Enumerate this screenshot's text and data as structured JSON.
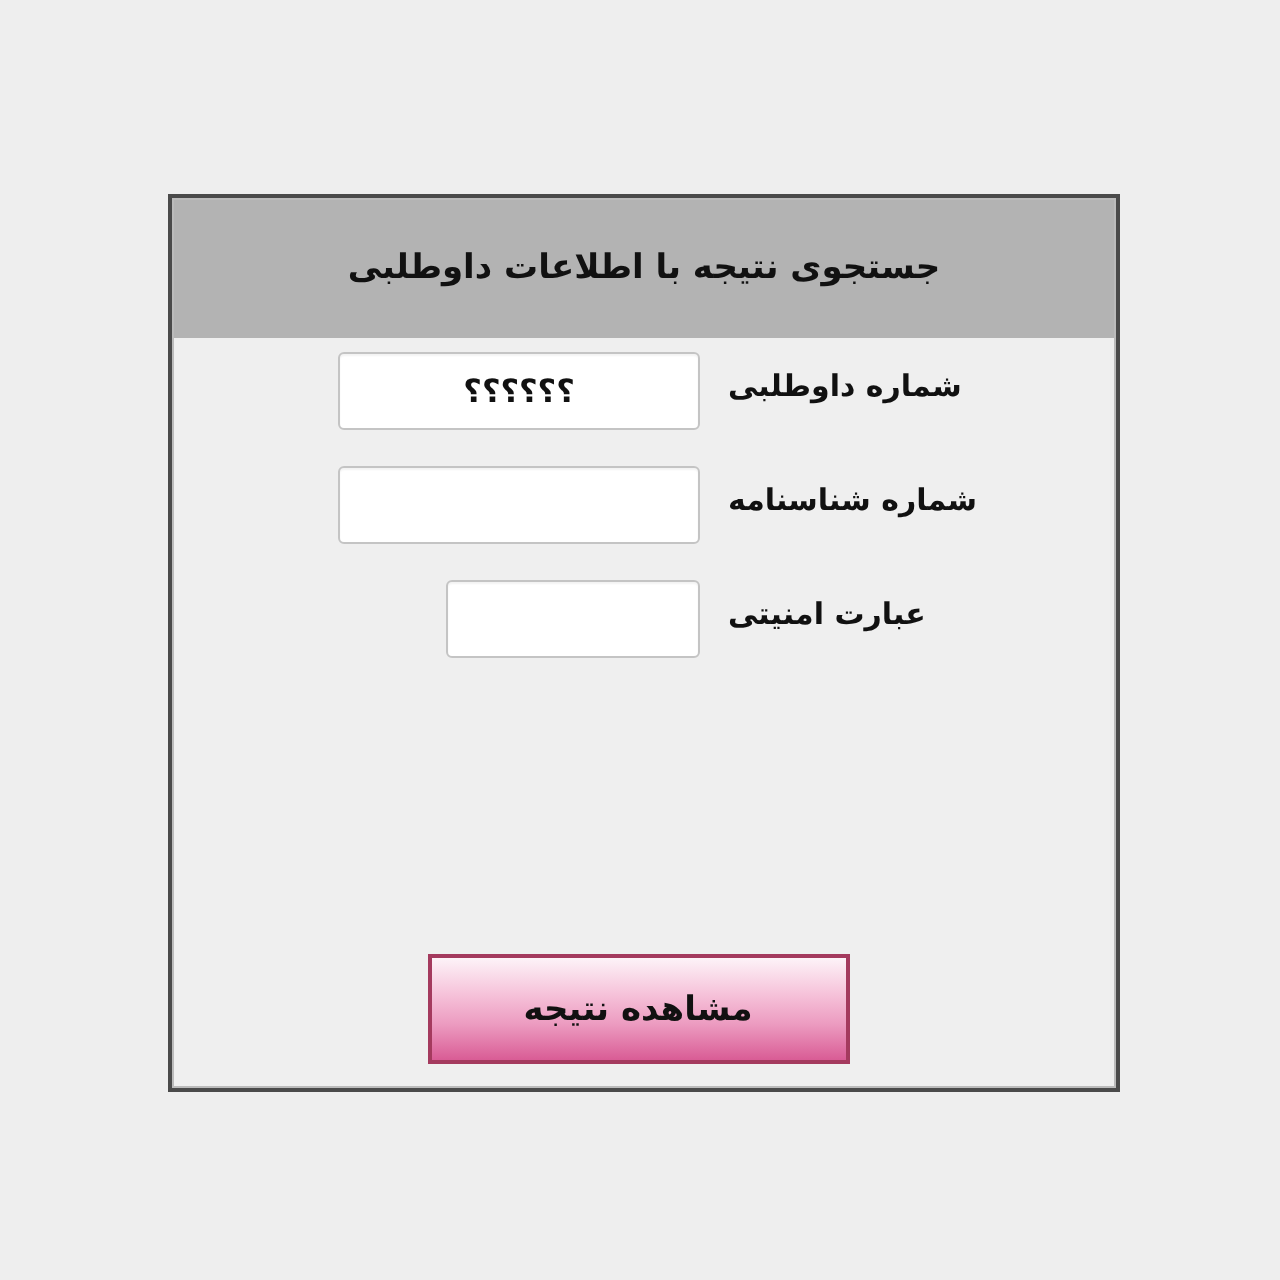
{
  "form": {
    "title": "جستجوی نتیجه با اطلاعات داوطلبی",
    "fields": [
      {
        "label": "شماره داوطلبی",
        "kind": "text",
        "value": "؟؟؟؟؟؟"
      },
      {
        "label": "شماره شناسنامه",
        "kind": "text"
      },
      {
        "label": "عبارت امنیتی",
        "kind": "captcha"
      }
    ],
    "submit": {
      "label": "مشاهده نتیجه"
    }
  }
}
